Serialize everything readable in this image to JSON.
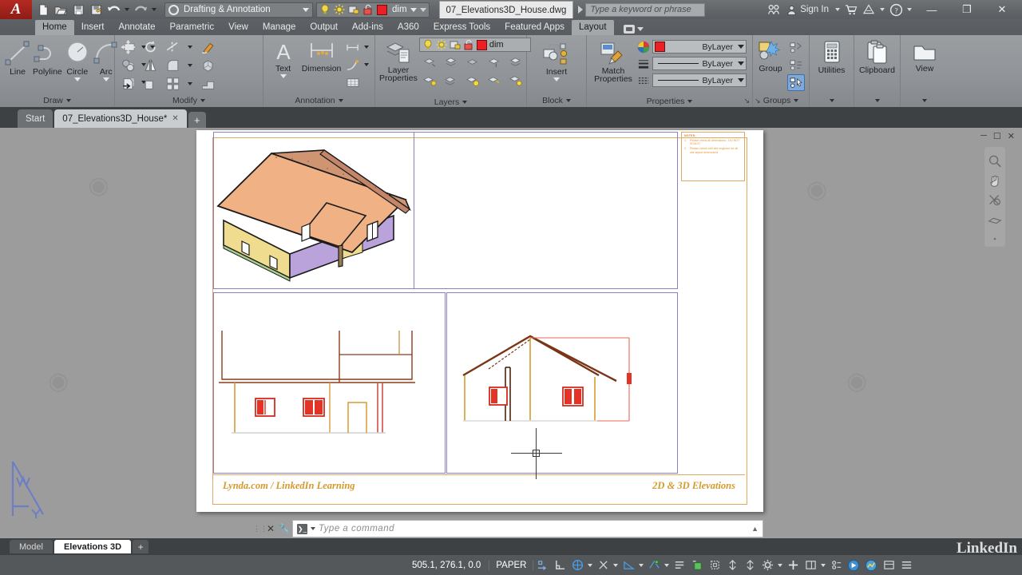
{
  "titlebar": {
    "logo": "A",
    "qat": [
      {
        "name": "new-file",
        "label": "New"
      },
      {
        "name": "open-file",
        "label": "Open"
      },
      {
        "name": "save-file",
        "label": "Save"
      },
      {
        "name": "save-as",
        "label": "Save As"
      },
      {
        "name": "undo",
        "label": "Undo"
      },
      {
        "name": "redo",
        "label": "Redo"
      }
    ],
    "workspace": "Drafting & Annotation",
    "layer_quick": "dim",
    "layer_color": "#ec2024",
    "document": "07_Elevations3D_House.dwg",
    "search_placeholder": "Type a keyword or phrase",
    "signin": "Sign In",
    "window_minimize": "—",
    "window_restore": "❐",
    "window_close": "✕"
  },
  "ribbon_tabs": [
    {
      "label": "Home",
      "active": true
    },
    {
      "label": "Insert",
      "active": false
    },
    {
      "label": "Annotate",
      "active": false
    },
    {
      "label": "Parametric",
      "active": false
    },
    {
      "label": "View",
      "active": false
    },
    {
      "label": "Manage",
      "active": false
    },
    {
      "label": "Output",
      "active": false
    },
    {
      "label": "Add-ins",
      "active": false
    },
    {
      "label": "A360",
      "active": false
    },
    {
      "label": "Express Tools",
      "active": false
    },
    {
      "label": "Featured Apps",
      "active": false
    },
    {
      "label": "Layout",
      "active": true
    }
  ],
  "ribbon_panels": {
    "draw": {
      "title": "Draw",
      "buttons": [
        {
          "name": "line-tool",
          "label": "Line"
        },
        {
          "name": "polyline-tool",
          "label": "Polyline"
        },
        {
          "name": "circle-tool",
          "label": "Circle"
        },
        {
          "name": "arc-tool",
          "label": "Arc"
        }
      ],
      "small": [
        "rectangle-icon",
        "hatch-icon",
        "gradient-icon"
      ]
    },
    "modify": {
      "title": "Modify",
      "small": [
        "move-icon",
        "rotate-icon",
        "trim-icon",
        "erase-icon",
        "copy-icon",
        "mirror-icon",
        "fillet-icon",
        "explode-icon",
        "stretch-icon",
        "scale-icon",
        "array-icon",
        "extrude-icon"
      ]
    },
    "annotation": {
      "title": "Annotation",
      "buttons": [
        {
          "name": "text-tool",
          "label": "Text"
        },
        {
          "name": "dimension-tool",
          "label": "Dimension"
        }
      ],
      "small": [
        "leader-icon",
        "multileader-icon",
        "table-icon"
      ]
    },
    "layers": {
      "title": "Layers",
      "button": {
        "name": "layer-properties-tool",
        "label": "Layer\nProperties"
      },
      "current_layer": "dim",
      "current_layer_color": "#ec2024"
    },
    "block": {
      "title": "Block",
      "button": {
        "name": "insert-block-tool",
        "label": "Insert"
      }
    },
    "properties": {
      "title": "Properties",
      "rows": [
        {
          "name": "object-color",
          "value": "ByLayer",
          "swatch": "#ec2024"
        },
        {
          "name": "lineweight",
          "value": "ByLayer"
        },
        {
          "name": "linetype",
          "value": "ByLayer"
        }
      ]
    },
    "groups": {
      "title": "Groups",
      "button": {
        "name": "group-tool",
        "label": "Group"
      }
    },
    "utilities": {
      "title": "Utilities",
      "label": "Utilities"
    },
    "clipboard": {
      "title": "Clipboard",
      "label": "Clipboard"
    },
    "view": {
      "title": "View",
      "label": "View"
    }
  },
  "file_tabs": [
    {
      "label": "Start",
      "active": false
    },
    {
      "label": "07_Elevations3D_House*",
      "active": true
    }
  ],
  "file_tab_add": "+",
  "drawing": {
    "notes": {
      "title": "NOTES:",
      "items": [
        {
          "n": "1.",
          "t": "Please check all dimensions - DO NOT SCALE!"
        },
        {
          "n": "2.",
          "t": "Please check with site engineer for all site layout dimensions"
        }
      ]
    },
    "title_block_left": "Lynda.com / LinkedIn Learning",
    "title_block_right": "2D & 3D Elevations",
    "viewports": [
      {
        "name": "viewport-3d-isometric",
        "content": "3D isometric house model"
      },
      {
        "name": "viewport-front-elevation",
        "content": "Front elevation 2D"
      },
      {
        "name": "viewport-side-elevation",
        "content": "Side / gable elevation 2D"
      }
    ],
    "viewport_controls": [
      "minimize",
      "restore",
      "close"
    ],
    "navbar_icons": [
      "zoom-extents-icon",
      "pan-icon",
      "orbit-icon",
      "steeringwheel-icon",
      "showmotion-icon"
    ]
  },
  "command_line": {
    "placeholder": "Type a command",
    "prompt": "❯_"
  },
  "layout_tabs": [
    {
      "label": "Model",
      "active": false
    },
    {
      "label": "Elevations 3D",
      "active": true
    }
  ],
  "layout_tab_add": "+",
  "statusbar": {
    "coordinates": "505.1, 276.1, 0.0",
    "space": "PAPER",
    "icons": [
      "infer-constraints-icon",
      "snap-mode-icon",
      "grid-display-icon",
      "ortho-mode-icon",
      "polar-tracking-icon",
      "object-snap-icon",
      "object-snap-tracking-icon",
      "annotation-visibility-icon",
      "annotation-scale-icon",
      "viewport-lock-icon",
      "isolate-objects-icon",
      "hardware-accel-icon",
      "isolate-icon",
      "customization-icon",
      "add-scale-icon",
      "workspace-switch-icon",
      "annotation-monitor-icon",
      "clean-screen-icon",
      "quickprop-icon"
    ]
  },
  "watermark": {
    "brand": "LinkedIn"
  }
}
